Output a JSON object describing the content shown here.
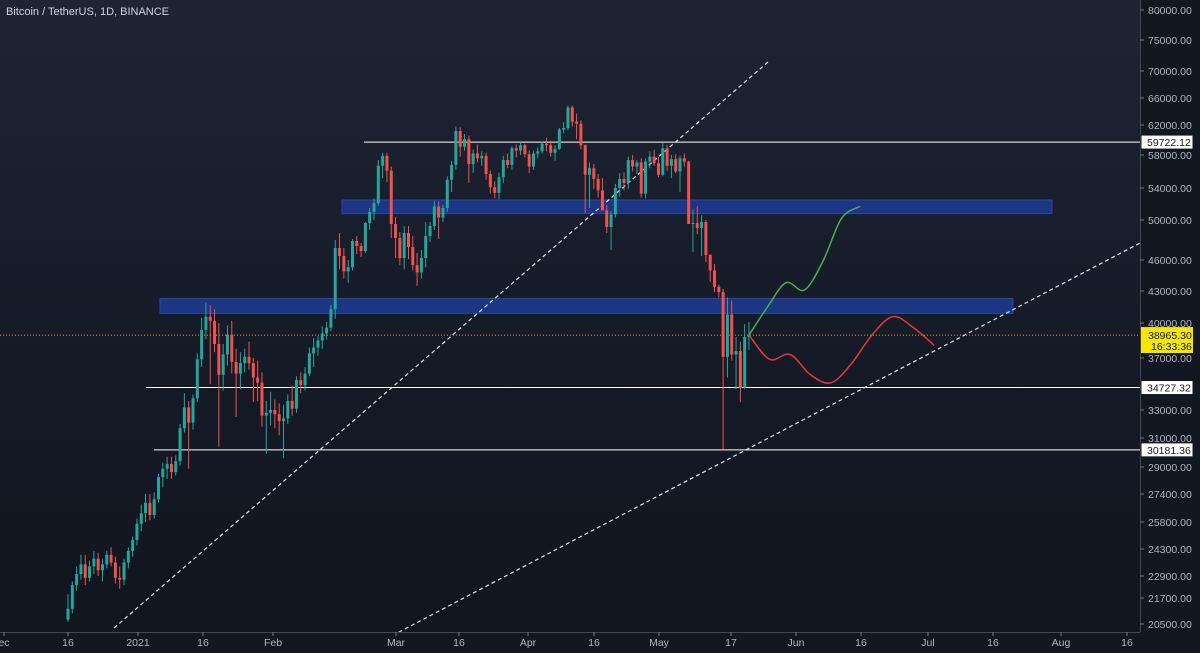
{
  "header": {
    "title": "Bitcoin / TetherUS, 1D, BINANCE"
  },
  "chart_data": {
    "type": "candlestick",
    "title": "Bitcoin / TetherUS, 1D, BINANCE",
    "y_ticks": [
      "80000.00",
      "75000.00",
      "70000.00",
      "66000.00",
      "62000.00",
      "58000.00",
      "54000.00",
      "50000.00",
      "46000.00",
      "43000.00",
      "40000.00",
      "37000.00",
      "33000.00",
      "31000.00",
      "29000.00",
      "27400.00",
      "25800.00",
      "24300.00",
      "22900.00",
      "21700.00",
      "20500.00"
    ],
    "x_ticks": [
      "ec",
      "16",
      "2021",
      "16",
      "Feb",
      "Mar",
      "16",
      "Apr",
      "16",
      "May",
      "17",
      "Jun",
      "16",
      "Jul",
      "16",
      "Aug",
      "16"
    ],
    "current_price": {
      "value": "38965.30",
      "countdown": "16:33:36"
    },
    "price_labels": [
      "59722.12",
      "34727.32",
      "30181.36"
    ],
    "colors": {
      "up": "#26a69a",
      "down": "#ef5350",
      "zone": "#1e3fa0",
      "projection_up": "#4caf50",
      "projection_down": "#e53935",
      "current_tag": "#f5e50a"
    },
    "ohlc": [
      [
        20700,
        21900,
        20600,
        21200
      ],
      [
        21200,
        22600,
        21000,
        22400
      ],
      [
        22400,
        23400,
        22100,
        23000
      ],
      [
        23000,
        24000,
        22700,
        23500
      ],
      [
        23500,
        24000,
        22400,
        22800
      ],
      [
        22800,
        23700,
        22600,
        23400
      ],
      [
        23400,
        24200,
        23000,
        23800
      ],
      [
        23800,
        24100,
        22900,
        23200
      ],
      [
        23200,
        23800,
        22600,
        23500
      ],
      [
        23500,
        24200,
        23300,
        24000
      ],
      [
        24000,
        24400,
        23400,
        23600
      ],
      [
        23600,
        23900,
        22500,
        22800
      ],
      [
        22800,
        23400,
        22200,
        22700
      ],
      [
        22700,
        23800,
        22400,
        23600
      ],
      [
        23600,
        24400,
        23300,
        24200
      ],
      [
        24200,
        25000,
        23900,
        24800
      ],
      [
        24800,
        26000,
        24500,
        25700
      ],
      [
        25700,
        26800,
        25300,
        26300
      ],
      [
        26300,
        27400,
        25800,
        26900
      ],
      [
        26900,
        27400,
        25900,
        26200
      ],
      [
        26200,
        27500,
        26000,
        27100
      ],
      [
        27100,
        28600,
        26900,
        28400
      ],
      [
        28400,
        29300,
        27800,
        28900
      ],
      [
        28900,
        29700,
        28300,
        29200
      ],
      [
        29200,
        29700,
        28300,
        28700
      ],
      [
        28700,
        29800,
        28500,
        29400
      ],
      [
        29400,
        32000,
        29100,
        31700
      ],
      [
        31700,
        34300,
        31400,
        33200
      ],
      [
        33200,
        33700,
        28900,
        32100
      ],
      [
        32100,
        34200,
        31600,
        33900
      ],
      [
        33900,
        37400,
        33600,
        36900
      ],
      [
        36900,
        40500,
        36300,
        39400
      ],
      [
        39400,
        41900,
        38600,
        40600
      ],
      [
        40600,
        41700,
        35000,
        40200
      ],
      [
        40200,
        41300,
        37500,
        38200
      ],
      [
        38200,
        40000,
        30400,
        35700
      ],
      [
        35700,
        38200,
        34500,
        37300
      ],
      [
        37300,
        39800,
        36400,
        39000
      ],
      [
        39000,
        40200,
        35800,
        36700
      ],
      [
        36700,
        37800,
        32500,
        35800
      ],
      [
        35800,
        37500,
        34600,
        36600
      ],
      [
        36600,
        37800,
        35900,
        37100
      ],
      [
        37100,
        38400,
        36100,
        36600
      ],
      [
        36600,
        37000,
        33600,
        35500
      ],
      [
        35500,
        36800,
        33700,
        35100
      ],
      [
        35100,
        35900,
        31800,
        32600
      ],
      [
        32600,
        33700,
        29900,
        32800
      ],
      [
        32800,
        34400,
        31900,
        33000
      ],
      [
        33000,
        33800,
        31700,
        32700
      ],
      [
        32700,
        33500,
        31200,
        32200
      ],
      [
        32200,
        33400,
        29600,
        32400
      ],
      [
        32400,
        34200,
        32000,
        33700
      ],
      [
        33700,
        34900,
        32600,
        33100
      ],
      [
        33100,
        35600,
        32800,
        35300
      ],
      [
        35300,
        35900,
        34300,
        34900
      ],
      [
        34900,
        36300,
        34500,
        35800
      ],
      [
        35800,
        37900,
        35600,
        37400
      ],
      [
        37400,
        38700,
        36300,
        37900
      ],
      [
        37900,
        38900,
        37200,
        38500
      ],
      [
        38500,
        39700,
        37800,
        39100
      ],
      [
        39100,
        40100,
        38600,
        39600
      ],
      [
        39600,
        41700,
        39300,
        41300
      ],
      [
        41300,
        48000,
        40400,
        47200
      ],
      [
        47200,
        48700,
        45100,
        46400
      ],
      [
        46400,
        47200,
        44200,
        44900
      ],
      [
        44900,
        46000,
        43800,
        45300
      ],
      [
        45300,
        48100,
        45000,
        47900
      ],
      [
        47900,
        48400,
        46600,
        47400
      ],
      [
        47400,
        47700,
        46300,
        46900
      ],
      [
        46900,
        49800,
        46700,
        49700
      ],
      [
        49700,
        51500,
        49000,
        51000
      ],
      [
        51000,
        52700,
        50000,
        52100
      ],
      [
        52100,
        57400,
        51800,
        56700
      ],
      [
        56700,
        58300,
        55200,
        57900
      ],
      [
        57900,
        58300,
        54700,
        56100
      ],
      [
        56100,
        56600,
        48200,
        49600
      ],
      [
        49600,
        50400,
        46200,
        48200
      ],
      [
        48200,
        48800,
        45500,
        46200
      ],
      [
        46200,
        49400,
        45100,
        48700
      ],
      [
        48700,
        49400,
        46100,
        47300
      ],
      [
        47300,
        48400,
        45000,
        45500
      ],
      [
        45500,
        46700,
        43500,
        44800
      ],
      [
        44800,
        47000,
        44200,
        46200
      ],
      [
        46200,
        49800,
        45300,
        48400
      ],
      [
        48400,
        49800,
        47800,
        49400
      ],
      [
        49400,
        52400,
        49000,
        51700
      ],
      [
        51700,
        52300,
        48100,
        50300
      ],
      [
        50300,
        51900,
        49800,
        51500
      ],
      [
        51500,
        55400,
        51000,
        55000
      ],
      [
        55000,
        57300,
        53500,
        56800
      ],
      [
        56800,
        61800,
        56200,
        61200
      ],
      [
        61200,
        61700,
        57800,
        59100
      ],
      [
        59100,
        60800,
        58600,
        60100
      ],
      [
        60100,
        60600,
        54600,
        56900
      ],
      [
        56900,
        58700,
        55800,
        58200
      ],
      [
        58200,
        59400,
        57100,
        57600
      ],
      [
        57600,
        58500,
        56700,
        57900
      ],
      [
        57900,
        58300,
        55000,
        55700
      ],
      [
        55700,
        56100,
        53300,
        54100
      ],
      [
        54100,
        54800,
        52700,
        53400
      ],
      [
        53400,
        55900,
        52600,
        55300
      ],
      [
        55300,
        57900,
        54600,
        57400
      ],
      [
        57400,
        58200,
        56400,
        56800
      ],
      [
        56800,
        59200,
        56200,
        58900
      ],
      [
        58900,
        59400,
        57700,
        58600
      ],
      [
        58600,
        59700,
        58000,
        59300
      ],
      [
        59300,
        59500,
        57700,
        58100
      ],
      [
        58100,
        58600,
        55800,
        56600
      ],
      [
        56600,
        58600,
        56200,
        58200
      ],
      [
        58200,
        59000,
        57600,
        58500
      ],
      [
        58500,
        59800,
        58200,
        59500
      ],
      [
        59500,
        60300,
        58500,
        59300
      ],
      [
        59300,
        59900,
        57800,
        58300
      ],
      [
        58300,
        59300,
        57300,
        58800
      ],
      [
        58800,
        61600,
        58700,
        61400
      ],
      [
        61400,
        62400,
        60900,
        61600
      ],
      [
        61600,
        64900,
        61300,
        64600
      ],
      [
        64600,
        64900,
        61800,
        62500
      ],
      [
        62500,
        63700,
        60100,
        62200
      ],
      [
        62200,
        62700,
        58800,
        59300
      ],
      [
        59300,
        59400,
        50900,
        55600
      ],
      [
        55600,
        57100,
        51500,
        56400
      ],
      [
        56400,
        56900,
        53900,
        55100
      ],
      [
        55100,
        55700,
        52800,
        53700
      ],
      [
        53700,
        55200,
        52100,
        51200
      ],
      [
        51200,
        51900,
        48700,
        49300
      ],
      [
        49300,
        51100,
        47000,
        50700
      ],
      [
        50700,
        54500,
        50300,
        54000
      ],
      [
        54000,
        55800,
        52900,
        55100
      ],
      [
        55100,
        55900,
        53700,
        54600
      ],
      [
        54600,
        57800,
        53900,
        57400
      ],
      [
        57400,
        58000,
        56000,
        56600
      ],
      [
        56600,
        57400,
        55700,
        57100
      ],
      [
        57100,
        57600,
        52800,
        53300
      ],
      [
        53300,
        57600,
        52700,
        57200
      ],
      [
        57200,
        58500,
        56400,
        57800
      ],
      [
        57800,
        58700,
        56700,
        57000
      ],
      [
        57000,
        57800,
        55300,
        55600
      ],
      [
        55600,
        59600,
        55400,
        58900
      ],
      [
        58900,
        59300,
        56100,
        56700
      ],
      [
        56700,
        58000,
        55200,
        57500
      ],
      [
        57500,
        58100,
        55800,
        56000
      ],
      [
        56000,
        57900,
        53500,
        57600
      ],
      [
        57600,
        58200,
        56600,
        57200
      ],
      [
        57200,
        57300,
        49900,
        49600
      ],
      [
        49600,
        51300,
        46800,
        49700
      ],
      [
        49700,
        51700,
        48600,
        49200
      ],
      [
        49200,
        50600,
        46400,
        49800
      ],
      [
        49800,
        50000,
        45800,
        46500
      ],
      [
        46500,
        46600,
        43900,
        45000
      ],
      [
        45000,
        45600,
        42900,
        43400
      ],
      [
        43400,
        43600,
        42400,
        42900
      ],
      [
        42900,
        43200,
        30200,
        37100
      ],
      [
        37100,
        42400,
        35500,
        40800
      ],
      [
        40800,
        42100,
        36800,
        37300
      ],
      [
        37300,
        38800,
        34600,
        37600
      ],
      [
        37600,
        38400,
        33600,
        34700
      ],
      [
        34700,
        39900,
        34600,
        38800
      ],
      [
        38800,
        40100,
        37700,
        38965
      ]
    ],
    "zones": [
      {
        "from": 50800,
        "to": 52500
      },
      {
        "from": 40900,
        "to": 42300
      }
    ],
    "levels": [
      "59722.12",
      "34727.32",
      "30181.36"
    ],
    "projection_up": [
      38965,
      41500,
      43800,
      43100,
      45900,
      50200,
      51700
    ],
    "projection_down": [
      38965,
      36900,
      37300,
      35700,
      35100,
      36600,
      39000,
      40600,
      39600,
      38100
    ]
  }
}
